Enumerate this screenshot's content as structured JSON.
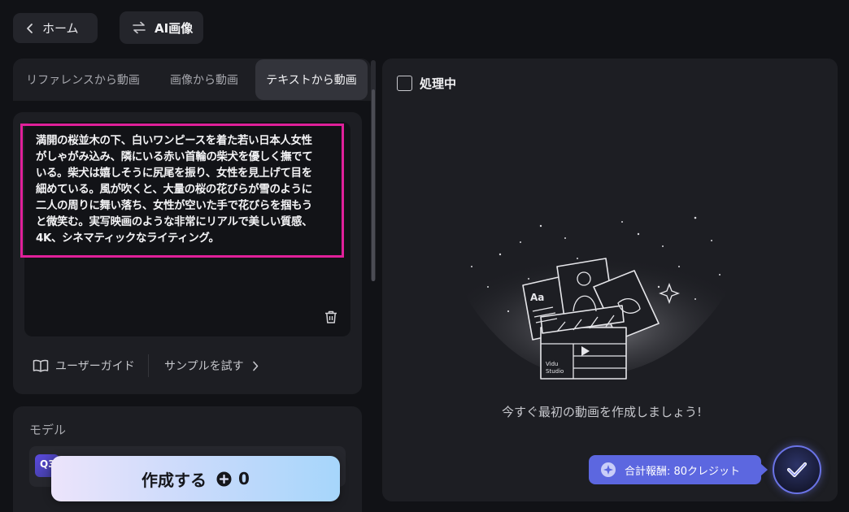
{
  "header": {
    "home_label": "ホーム",
    "switch_label": "AI画像"
  },
  "tabs": [
    {
      "label": "リファレンスから動画",
      "active": false
    },
    {
      "label": "画像から動画",
      "active": false
    },
    {
      "label": "テキストから動画",
      "active": true
    }
  ],
  "prompt": {
    "text": "満開の桜並木の下、白いワンピースを着た若い日本人女性\nがしゃがみ込み、隣にいる赤い首輪の柴犬を優しく撫でて\nいる。柴犬は嬉しそうに尻尾を振り、女性を見上げて目を\n細めている。風が吹くと、大量の桜の花びらが雪のように\n二人の周りに舞い落ち、女性が空いた手で花びらを掴もう\nと微笑む。実写映画のような非常にリアルで美しい質感、\n4K、シネマティックなライティング。",
    "highlight_color": "#e0209a"
  },
  "links": {
    "guide_label": "ユーザーガイド",
    "sample_label": "サンプルを試す"
  },
  "model": {
    "label": "モデル",
    "badge_text": "Q3"
  },
  "create": {
    "label": "作成する",
    "cost": "0"
  },
  "results": {
    "processing_label": "処理中",
    "processing_checked": false,
    "empty_message": "今すぐ最初の動画を作成しましょう!",
    "illustration_text": [
      "Aa",
      "Vidu",
      "Studio"
    ]
  },
  "reward": {
    "label": "合計報酬: 80クレジット",
    "color": "#5c67e0"
  },
  "icons": {
    "home": "chevron-left-icon",
    "switch": "swap-arrows-icon",
    "trash": "trash-icon",
    "guide": "book-icon",
    "sample": "chevron-right-icon",
    "create": "plus-circle-icon",
    "reward": "sparkle-icon",
    "reward_action": "check-icon"
  }
}
